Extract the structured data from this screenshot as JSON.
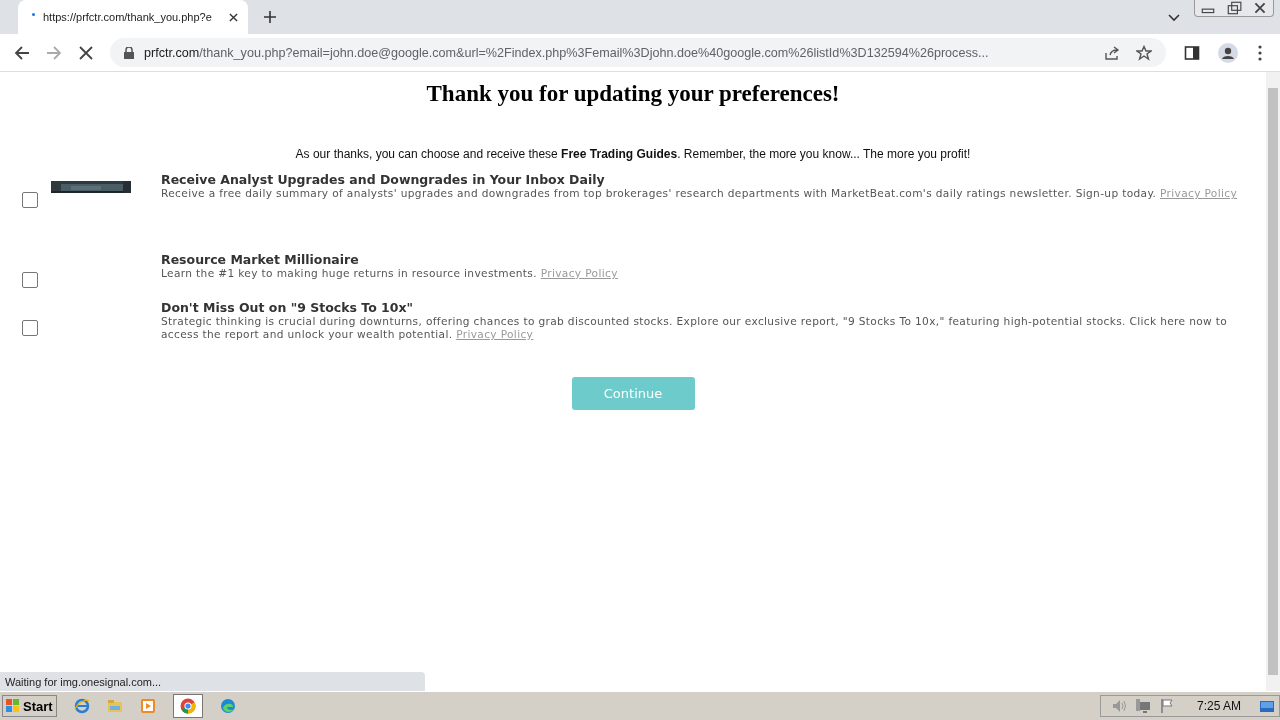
{
  "browser": {
    "tab": {
      "title": "https://prfctr.com/thank_you.php?e",
      "loading": true
    },
    "address": {
      "host": "prfctr.com",
      "path": "/thank_you.php?email=john.doe@google.com&url=%2Findex.php%3Femail%3Djohn.doe%40google.com%26listId%3D132594%26process..."
    }
  },
  "page": {
    "heading": "Thank you for updating your preferences!",
    "intro": "As our thanks, you can choose and receive these **Free Trading Guides**. Remember, the more you know... The more you profit!",
    "offers": [
      {
        "title": "Receive Analyst Upgrades and Downgrades in Your Inbox Daily",
        "description": "Receive a free daily summary of analysts' upgrades and downgrades from top brokerages' research departments with MarketBeat.com's daily ratings newsletter. Sign-up today.",
        "link": "Privacy Policy",
        "checked": false,
        "kind": "picture"
      },
      {
        "title": "Resource Market Millionaire",
        "description": "Learn the #1 key to making huge returns in resource investments.",
        "link": "Privacy Policy",
        "checked": false
      },
      {
        "title": "Don't Miss Out on \"9 Stocks To 10x\"",
        "description": "Strategic thinking is crucial during downturns, offering chances to grab discounted stocks. Explore our exclusive report, \"9 Stocks To 10x,\" featuring high-potential stocks. Click here now to access the report and unlock your wealth potential.",
        "link": "Privacy Policy",
        "checked": false
      }
    ],
    "button": "Continue"
  },
  "status": "Waiting for img.onesignal.com...",
  "taskbar": {
    "start": "Start",
    "clock": "7:25 AM"
  }
}
